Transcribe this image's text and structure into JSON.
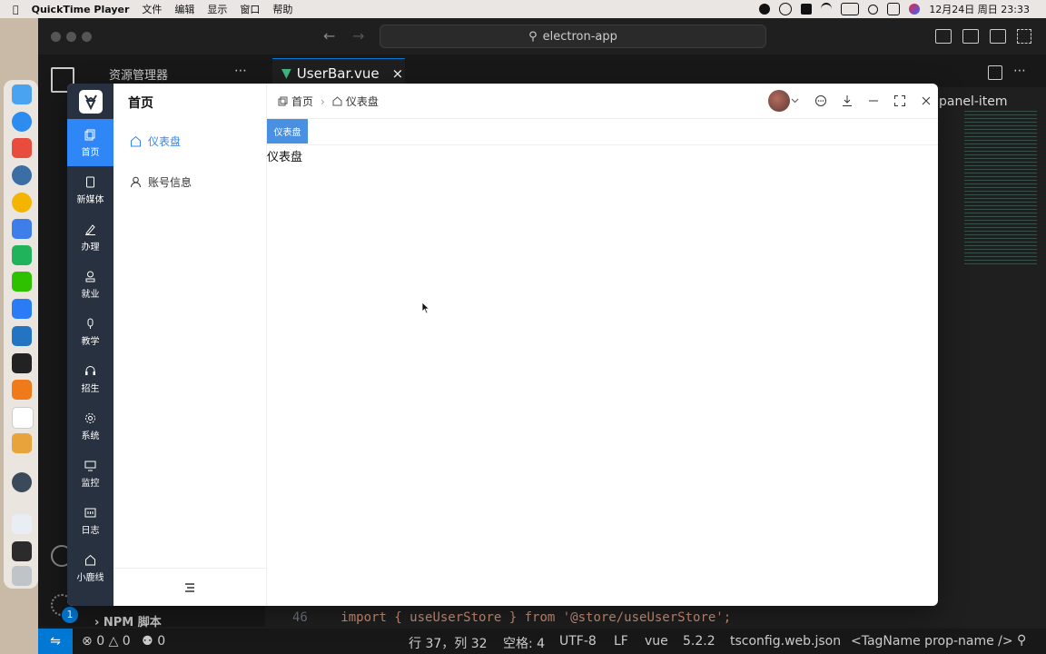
{
  "menubar": {
    "app_name": "QuickTime Player",
    "items": [
      "文件",
      "编辑",
      "显示",
      "窗口",
      "帮助"
    ],
    "clock": "12月24日 周日 23:33"
  },
  "vscode": {
    "search_text": "electron-app",
    "explorer_title": "资源管理器",
    "tab_label": "UserBar.vue",
    "side_text": "panel-item",
    "npm_label": "NPM 脚本",
    "code_line_number": "46",
    "code_line": "import { useUserStore } from '@store/useUserStore';",
    "status": {
      "errors": "0",
      "warnings": "0",
      "ports": "0",
      "position": "行 37，列 32",
      "spaces": "空格: 4",
      "encoding": "UTF-8",
      "eol": "LF",
      "language": "vue",
      "version": "5.2.2",
      "tsconfig": "tsconfig.web.json",
      "tagname": "<TagName prop-name />",
      "badge": "1"
    }
  },
  "app": {
    "nav": [
      {
        "label": "首页",
        "icon": "copy-icon",
        "active": true
      },
      {
        "label": "新媒体",
        "icon": "tablet-icon"
      },
      {
        "label": "办理",
        "icon": "pen-icon"
      },
      {
        "label": "就业",
        "icon": "user-stamp-icon"
      },
      {
        "label": "教学",
        "icon": "microphone-icon"
      },
      {
        "label": "招生",
        "icon": "headset-icon"
      },
      {
        "label": "系统",
        "icon": "gear-icon"
      },
      {
        "label": "监控",
        "icon": "monitor-icon"
      },
      {
        "label": "日志",
        "icon": "log-icon"
      },
      {
        "label": "小鹿线",
        "icon": "home-icon"
      }
    ],
    "menu_title": "首页",
    "menu_items": [
      {
        "label": "仪表盘",
        "icon": "home-icon",
        "active": true
      },
      {
        "label": "账号信息",
        "icon": "user-icon"
      }
    ],
    "breadcrumb": [
      "首页",
      "仪表盘"
    ],
    "tag": "仪表盘",
    "content": "仪表盘"
  },
  "colors": {
    "nav_bg": "#28313f",
    "accent": "#2f86f6"
  }
}
